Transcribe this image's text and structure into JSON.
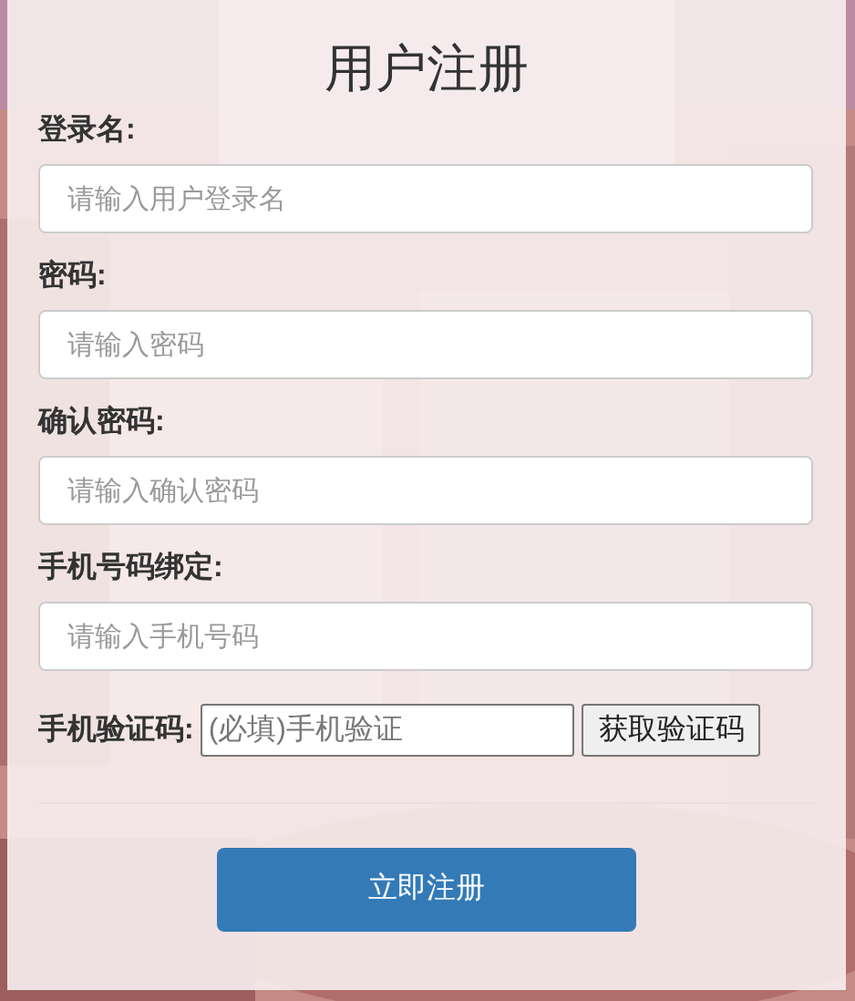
{
  "title": "用户注册",
  "fields": [
    {
      "kind": "text",
      "label": "登录名:",
      "placeholder": "请输入用户登录名"
    },
    {
      "kind": "text",
      "label": "密码:",
      "placeholder": "请输入密码"
    },
    {
      "kind": "text",
      "label": "确认密码:",
      "placeholder": "请输入确认密码"
    },
    {
      "kind": "text",
      "label": "手机号码绑定:",
      "placeholder": "请输入手机号码"
    },
    {
      "kind": "sms",
      "label": "手机验证码:",
      "placeholder": "(必填)手机验证",
      "button": "获取验证码"
    }
  ],
  "submit": "立即注册"
}
